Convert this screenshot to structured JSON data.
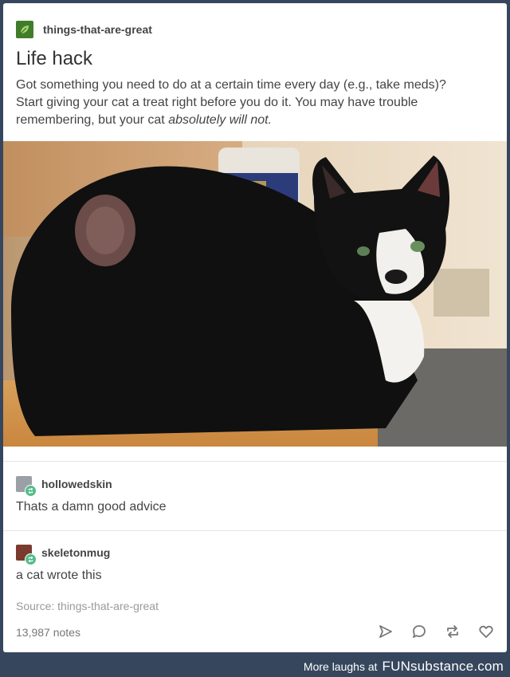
{
  "post": {
    "blog_name": "things-that-are-great",
    "title": "Life hack",
    "body_line_1": "Got something you need to do at a certain time every day (e.g., take meds)?",
    "body_line_2": "Start giving your cat a treat right before you do it.  You may have trouble",
    "body_line_3a": "remembering, but your cat ",
    "body_line_3b": "absolutely will not.",
    "image_alt": "tuxedo cat sitting on a wooden table next to a jar"
  },
  "reblogs": [
    {
      "name": "hollowedskin",
      "text": "Thats a damn good advice"
    },
    {
      "name": "skeletonmug",
      "text": "a cat wrote this"
    }
  ],
  "source": "Source: things-that-are-great",
  "notes": "13,987 notes",
  "actions": [
    "share-icon",
    "reply-icon",
    "reblog-icon",
    "like-icon"
  ],
  "footer": {
    "prefix": "More laughs at",
    "brand": "FUNsubstance.com"
  },
  "colors": {
    "background": "#36465d",
    "reblog_badge": "#56bc8a",
    "op_avatar": "#3f7d2a"
  }
}
